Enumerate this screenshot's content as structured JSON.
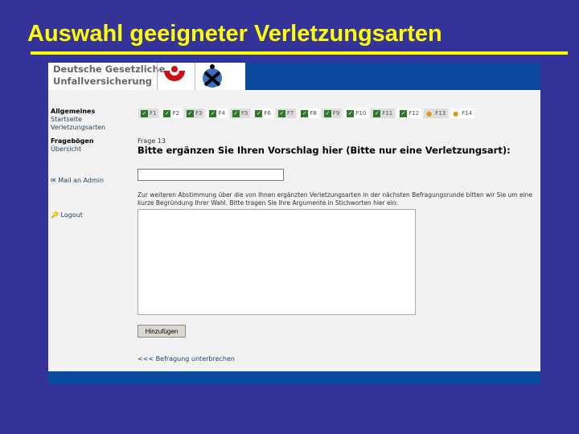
{
  "slide_title": "Auswahl geeigneter Verletzungsarten",
  "header": {
    "brand_line1": "Deutsche Gesetzliche",
    "brand_line2": "Unfallversicherung"
  },
  "sidebar": {
    "group1": "Allgemeines",
    "startseite": "Startseite",
    "verletzungsarten": "Verletzungsarten",
    "group2": "Fragebögen",
    "uebersicht": "Übersicht",
    "mail": "Mail an Admin",
    "logout": "Logout"
  },
  "tabs": [
    {
      "label": "F1",
      "status": "done"
    },
    {
      "label": "F2",
      "status": "done"
    },
    {
      "label": "F3",
      "status": "done"
    },
    {
      "label": "F4",
      "status": "done"
    },
    {
      "label": "F5",
      "status": "done"
    },
    {
      "label": "F6",
      "status": "done"
    },
    {
      "label": "F7",
      "status": "done"
    },
    {
      "label": "F8",
      "status": "done"
    },
    {
      "label": "F9",
      "status": "done"
    },
    {
      "label": "F10",
      "status": "done"
    },
    {
      "label": "F11",
      "status": "done"
    },
    {
      "label": "F12",
      "status": "done"
    },
    {
      "label": "F13",
      "status": "open"
    },
    {
      "label": "F14",
      "status": "open"
    }
  ],
  "main": {
    "question_number": "Frage 13",
    "question": "Bitte ergänzen Sie Ihren Vorschlag hier (Bitte nur eine Verletzungsart):",
    "input_value": "",
    "description": "Zur weiteren Abstimmung über die von Ihnen ergänzten Verletzungsarten in der nächsten Befragungsrunde bitten wir Sie um eine kurze Begründung Ihrer Wahl. Bitte tragen Sie Ihre Argumente in Stichworten hier ein:",
    "textarea_value": "",
    "add_button": "Hinzufügen",
    "back_link": "<<< Befragung unterbrechen"
  }
}
